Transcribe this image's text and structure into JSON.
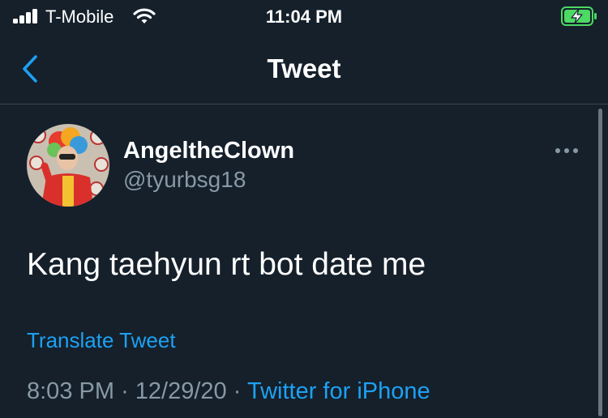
{
  "status_bar": {
    "carrier": "T-Mobile",
    "time": "11:04 PM",
    "signal_bars": 4,
    "battery_charging": true
  },
  "nav": {
    "title": "Tweet"
  },
  "tweet": {
    "display_name": "AngeltheClown",
    "handle": "@tyurbsg18",
    "text": "Kang taehyun rt bot date me",
    "translate_label": "Translate Tweet",
    "time": "8:03 PM",
    "separator": "·",
    "date": "12/29/20",
    "source": "Twitter for iPhone"
  },
  "colors": {
    "background": "#15202b",
    "accent": "#1da1f2",
    "secondary_text": "#8899a6",
    "battery": "#4cd964"
  }
}
